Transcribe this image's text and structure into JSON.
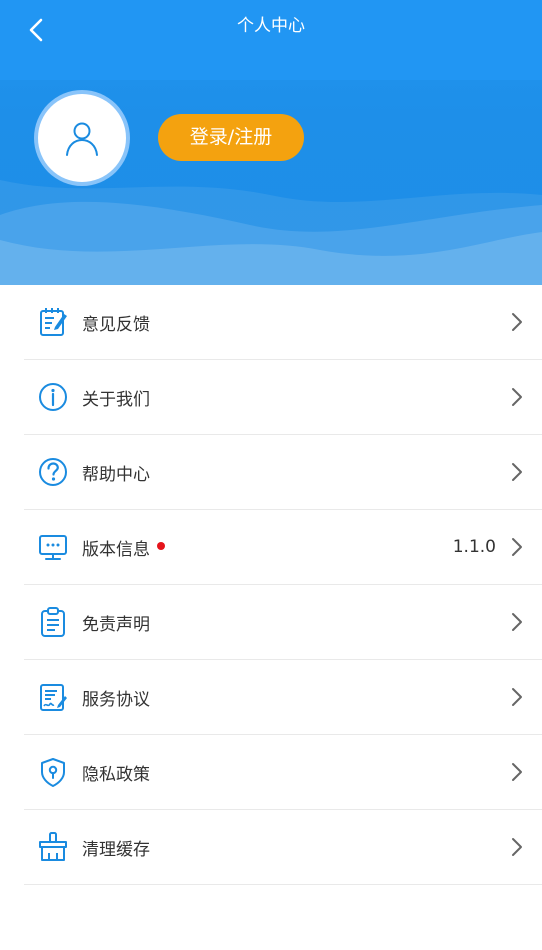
{
  "header": {
    "title": "个人中心",
    "back_icon": "chevron-left-icon",
    "avatar_icon": "user-icon",
    "login_label": "登录/注册"
  },
  "colors": {
    "header_blue": "#1f8ee6",
    "login_orange": "#f4a20f",
    "icon_blue": "#1a8be0",
    "badge_red": "#e5141b"
  },
  "menu": {
    "items": [
      {
        "label": "意见反馈",
        "icon": "edit-note-icon",
        "value": "",
        "badge": false
      },
      {
        "label": "关于我们",
        "icon": "info-icon",
        "value": "",
        "badge": false
      },
      {
        "label": "帮助中心",
        "icon": "question-icon",
        "value": "",
        "badge": false
      },
      {
        "label": "版本信息",
        "icon": "monitor-icon",
        "value": "1.1.0",
        "badge": true
      },
      {
        "label": "免责声明",
        "icon": "clipboard-icon",
        "value": "",
        "badge": false
      },
      {
        "label": "服务协议",
        "icon": "contract-icon",
        "value": "",
        "badge": false
      },
      {
        "label": "隐私政策",
        "icon": "shield-icon",
        "value": "",
        "badge": false
      },
      {
        "label": "清理缓存",
        "icon": "broom-icon",
        "value": "",
        "badge": false
      }
    ]
  }
}
